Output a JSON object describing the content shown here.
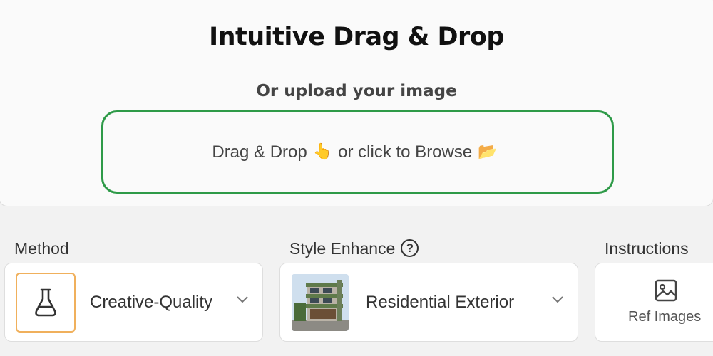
{
  "upload": {
    "title": "Intuitive Drag & Drop",
    "subtitle": "Or upload your image",
    "dropzone_text_1": "Drag & Drop",
    "dropzone_emoji_1": "👆",
    "dropzone_text_2": "or click to Browse",
    "dropzone_emoji_2": "📂"
  },
  "settings": {
    "method": {
      "label": "Method",
      "value": "Creative-Quality",
      "icon": "flask-icon"
    },
    "style_enhance": {
      "label": "Style Enhance",
      "help": "?",
      "value": "Residential Exterior",
      "icon": "building-thumbnail"
    },
    "instructions": {
      "label": "Instructions",
      "ref_images_label": "Ref Images",
      "icon": "image-icon"
    }
  },
  "colors": {
    "dropzone_border": "#2e9a48",
    "method_icon_border": "#f0b05c"
  }
}
